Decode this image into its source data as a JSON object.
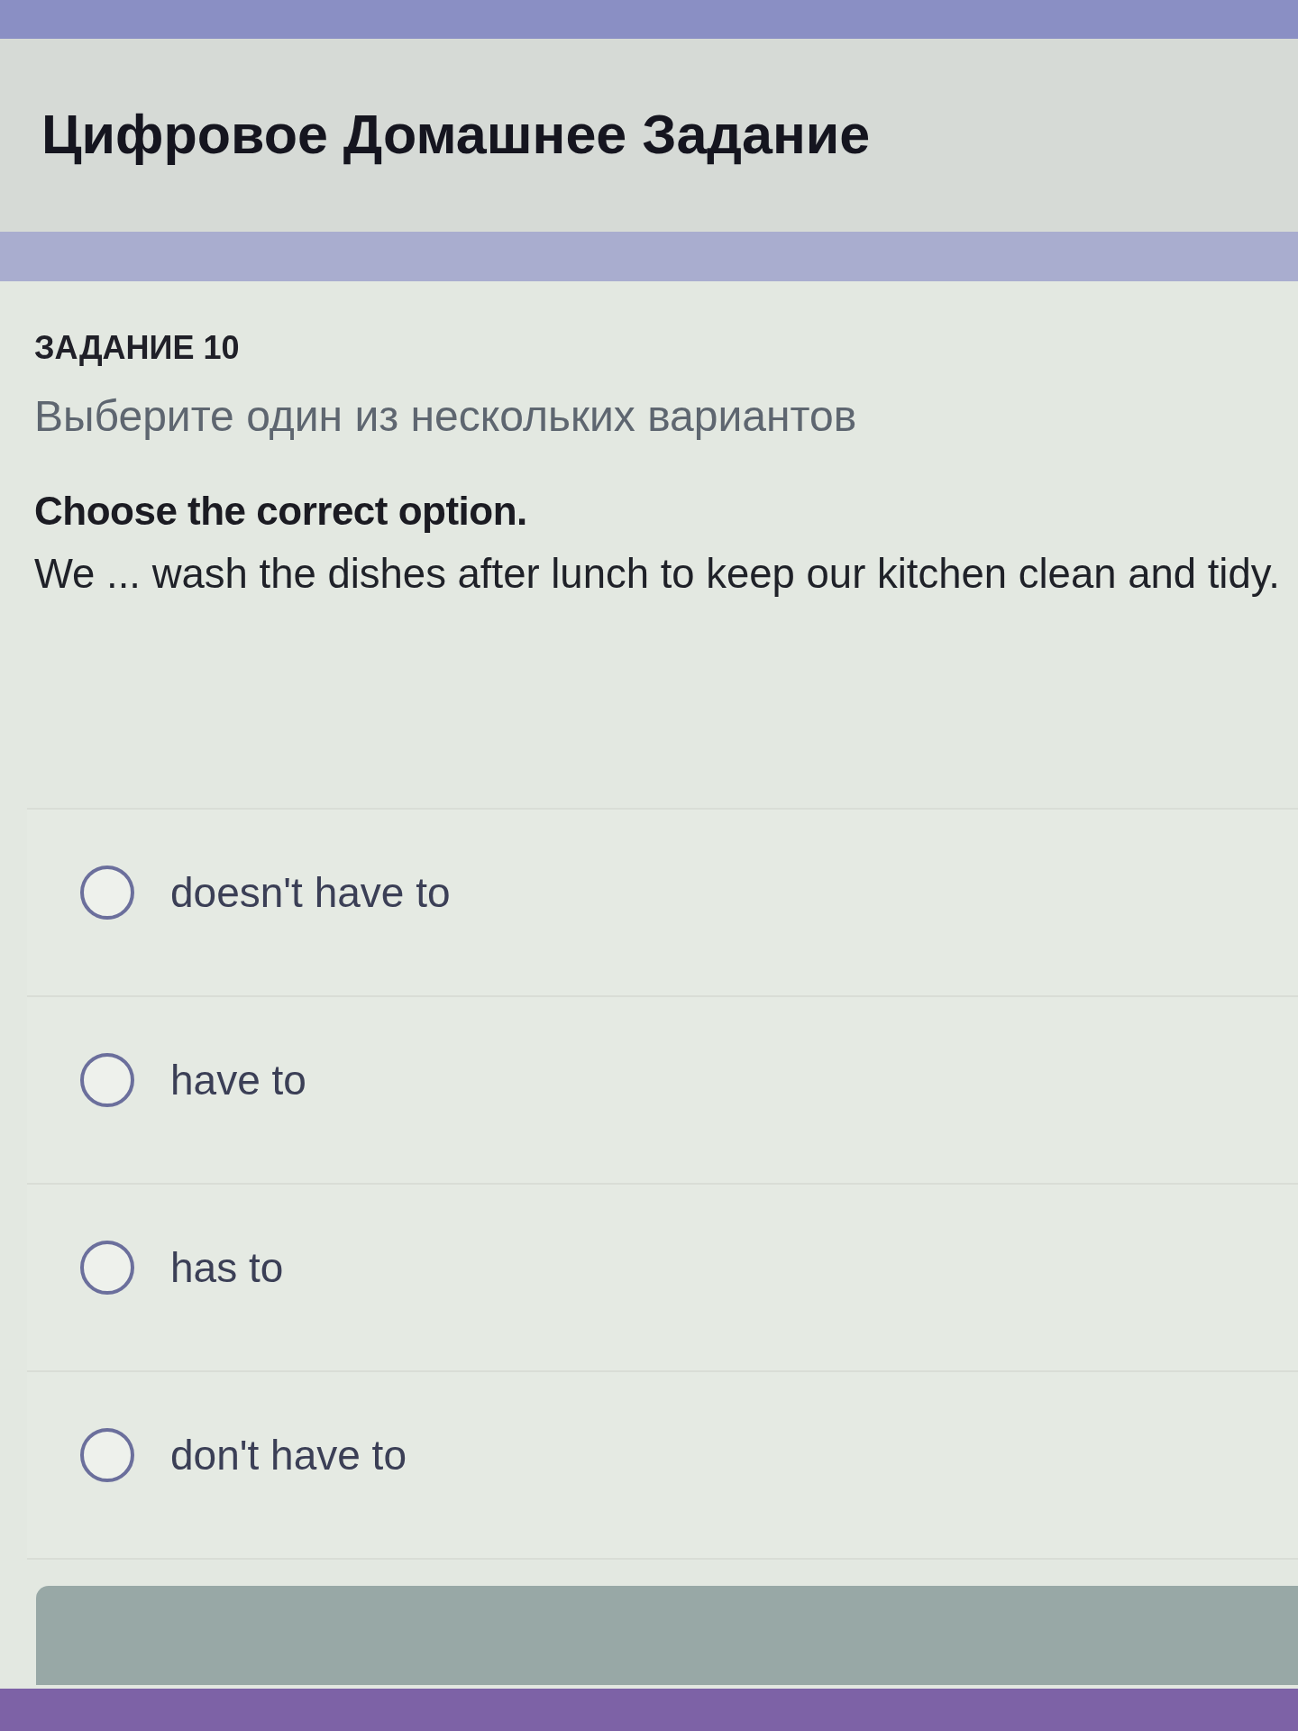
{
  "header": {
    "title": "Цифровое Домашнее Задание"
  },
  "task": {
    "label": "ЗАДАНИЕ 10",
    "instruction": "Выберите один из нескольких вариантов",
    "prompt": "Choose the correct option.",
    "sentence": "We ... wash the dishes after lunch to keep our kitchen clean and tidy."
  },
  "options": [
    {
      "label": "doesn't have to",
      "selected": false
    },
    {
      "label": "have to",
      "selected": false
    },
    {
      "label": "has to",
      "selected": false
    },
    {
      "label": "don't have to",
      "selected": false
    }
  ]
}
